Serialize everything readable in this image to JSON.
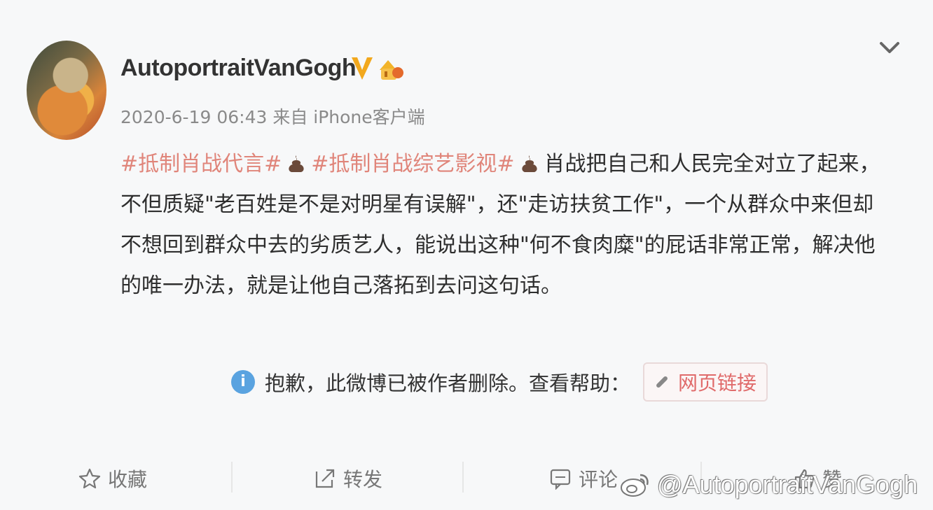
{
  "post": {
    "username": "AutoportraitVanGogh",
    "meta": "2020-6-19 06:43 来自 iPhone客户端",
    "tag1": "#抵制肖战代言#",
    "tag2": "#抵制肖战综艺影视#",
    "line1_rest": "肖战把自己和人民完全对立了起来，",
    "line2": "不但质疑\"老百姓是不是对明星有误解\"，还\"走访扶贫工作\"，一个从群众中来但却",
    "line3": "不想回到群众中去的劣质艺人，能说出这种\"何不食肉糜\"的屁话非常正常，解决他",
    "line4": "的唯一办法，就是让他自己落拓到去问这句话。"
  },
  "notice": {
    "text": "抱歉，此微博已被作者删除。查看帮助：",
    "link_label": "网页链接"
  },
  "actions": {
    "favorite": "收藏",
    "repost": "转发",
    "comment": "评论",
    "like": "赞"
  },
  "watermark": "@AutoportraitVanGogh",
  "colors": {
    "tag": "#e0857a",
    "link": "#e06a6a",
    "info": "#5aa3e0",
    "verified": "#f2a81d"
  }
}
